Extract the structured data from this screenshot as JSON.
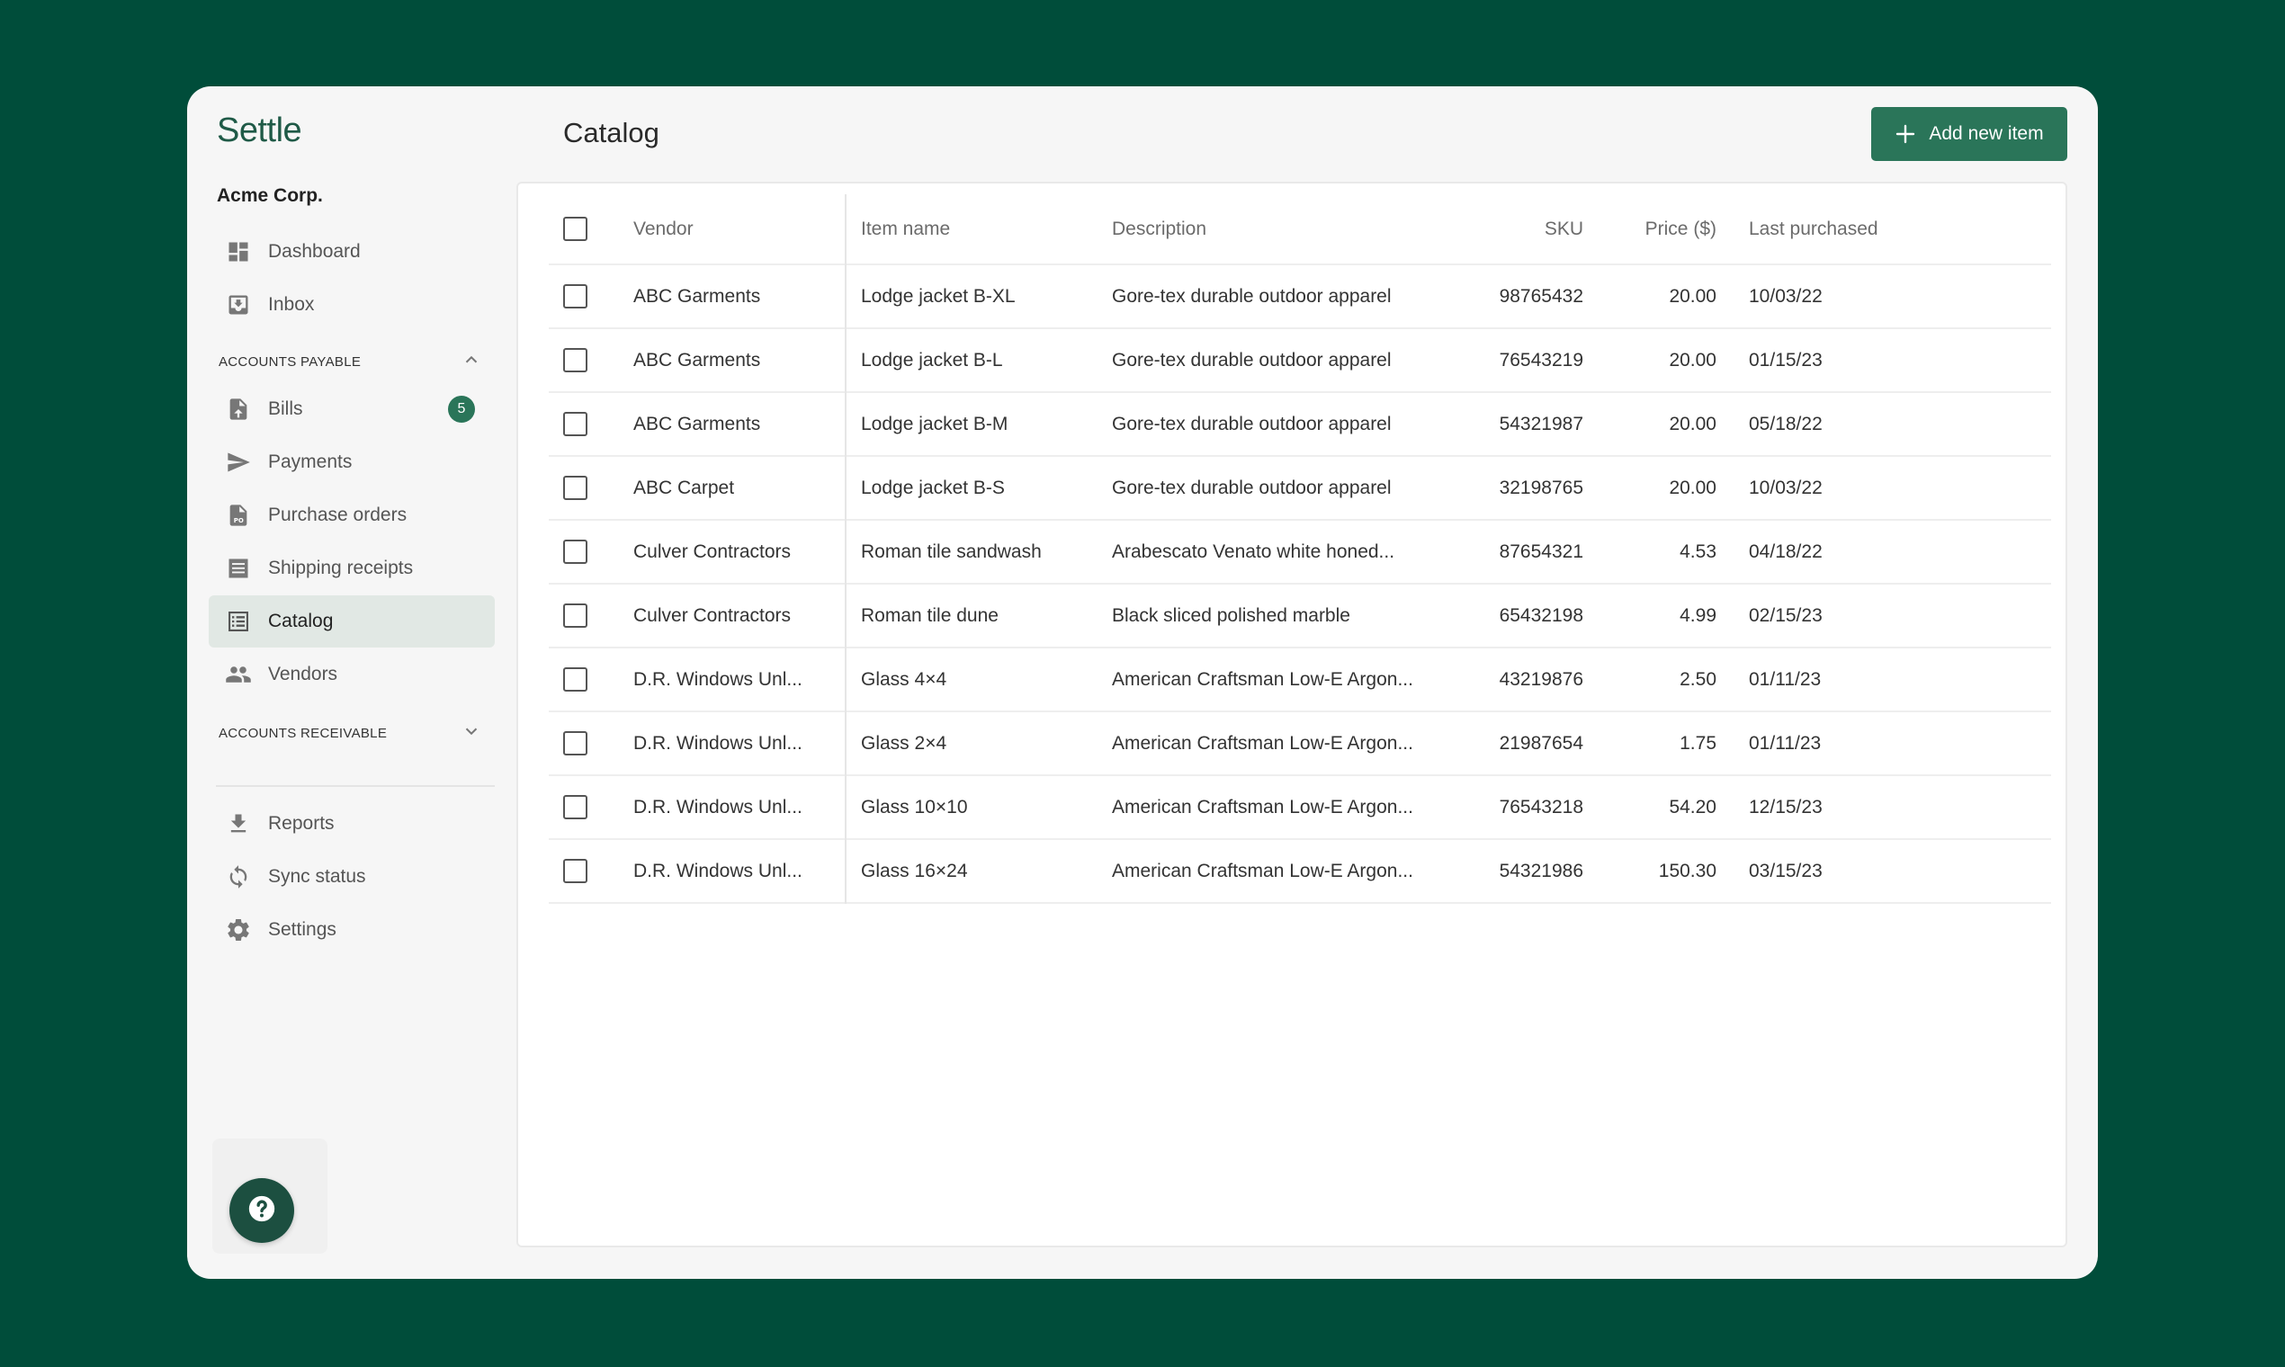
{
  "app": {
    "logo": "Settle",
    "org": "Acme Corp."
  },
  "nav": {
    "dashboard": "Dashboard",
    "inbox": "Inbox",
    "ap_section": "ACCOUNTS PAYABLE",
    "bills": "Bills",
    "bills_badge": "5",
    "payments": "Payments",
    "purchase_orders": "Purchase orders",
    "shipping_receipts": "Shipping receipts",
    "catalog": "Catalog",
    "vendors": "Vendors",
    "ar_section": "ACCOUNTS RECEIVABLE",
    "reports": "Reports",
    "sync_status": "Sync status",
    "settings": "Settings"
  },
  "page": {
    "title": "Catalog",
    "add_label": "Add new item"
  },
  "table": {
    "headers": {
      "vendor": "Vendor",
      "item": "Item name",
      "description": "Description",
      "sku": "SKU",
      "price": "Price ($)",
      "last": "Last purchased"
    },
    "rows": [
      {
        "vendor": "ABC Garments",
        "item": "Lodge jacket B-XL",
        "description": "Gore-tex durable outdoor apparel",
        "sku": "98765432",
        "price": "20.00",
        "last": "10/03/22"
      },
      {
        "vendor": "ABC Garments",
        "item": "Lodge jacket B-L",
        "description": "Gore-tex durable outdoor apparel",
        "sku": "76543219",
        "price": "20.00",
        "last": "01/15/23"
      },
      {
        "vendor": "ABC Garments",
        "item": "Lodge jacket B-M",
        "description": "Gore-tex durable outdoor apparel",
        "sku": "54321987",
        "price": "20.00",
        "last": "05/18/22"
      },
      {
        "vendor": "ABC Carpet",
        "item": "Lodge jacket B-S",
        "description": "Gore-tex durable outdoor apparel",
        "sku": "32198765",
        "price": "20.00",
        "last": "10/03/22"
      },
      {
        "vendor": "Culver Contractors",
        "item": "Roman tile sandwash",
        "description": "Arabescato Venato white honed...",
        "sku": "87654321",
        "price": "4.53",
        "last": "04/18/22"
      },
      {
        "vendor": "Culver Contractors",
        "item": "Roman tile dune",
        "description": "Black sliced polished marble",
        "sku": "65432198",
        "price": "4.99",
        "last": "02/15/23"
      },
      {
        "vendor": "D.R. Windows Unl...",
        "item": "Glass 4×4",
        "description": "American Craftsman Low-E Argon...",
        "sku": "43219876",
        "price": "2.50",
        "last": "01/11/23"
      },
      {
        "vendor": "D.R. Windows Unl...",
        "item": "Glass 2×4",
        "description": "American Craftsman Low-E Argon...",
        "sku": "21987654",
        "price": "1.75",
        "last": "01/11/23"
      },
      {
        "vendor": "D.R. Windows Unl...",
        "item": "Glass 10×10",
        "description": "American Craftsman Low-E Argon...",
        "sku": "76543218",
        "price": "54.20",
        "last": "12/15/23"
      },
      {
        "vendor": "D.R. Windows Unl...",
        "item": "Glass 16×24",
        "description": "American Craftsman Low-E Argon...",
        "sku": "54321986",
        "price": "150.30",
        "last": "03/15/23"
      }
    ]
  },
  "colors": {
    "brand": "#2a7559",
    "background": "#004d3a",
    "panel": "#f6f6f6"
  },
  "icons": {
    "dashboard": "dashboard-icon",
    "inbox": "inbox-icon",
    "bills": "file-upload-icon",
    "payments": "send-icon",
    "purchase_orders": "po-document-icon",
    "shipping": "receipt-icon",
    "catalog": "list-icon",
    "vendors": "people-icon",
    "reports": "download-icon",
    "sync": "sync-icon",
    "settings": "gear-icon",
    "help": "help-icon"
  }
}
